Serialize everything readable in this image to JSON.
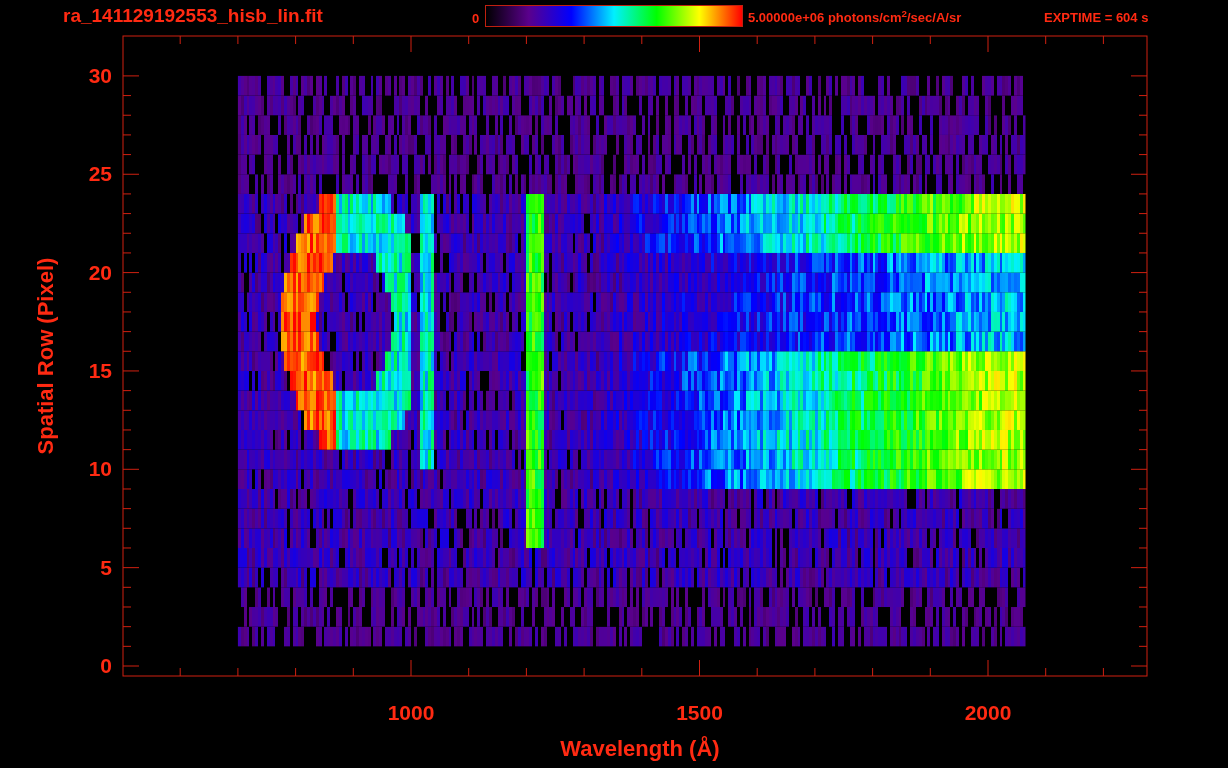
{
  "title": "ra_141129192553_hisb_lin.fit",
  "colorbar": {
    "min_label": "0",
    "max_label": "5.00000e+06 photons/cm$^{2}$/sec/A/sr"
  },
  "exposure": "EXPTIME = 604 s",
  "y_axis": {
    "label": "Spatial Row (Pixel)",
    "ticks": [
      "30",
      "25",
      "20",
      "15",
      "10",
      "5",
      "0"
    ]
  },
  "x_axis": {
    "label": "Wavelength (Å)",
    "ticks": [
      "1000",
      "1500",
      "2000"
    ]
  }
}
